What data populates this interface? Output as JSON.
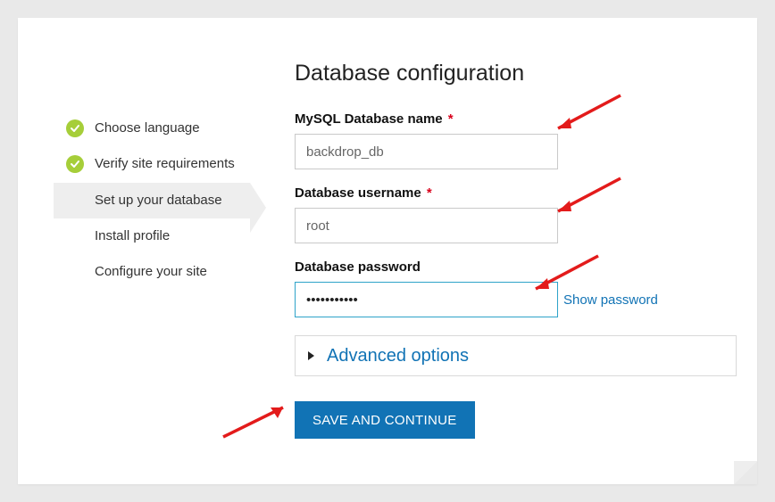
{
  "page_title": "Database configuration",
  "sidebar": {
    "items": [
      {
        "label": "Choose language",
        "state": "done"
      },
      {
        "label": "Verify site requirements",
        "state": "done"
      },
      {
        "label": "Set up your database",
        "state": "active"
      },
      {
        "label": "Install profile",
        "state": "pending"
      },
      {
        "label": "Configure your site",
        "state": "pending"
      }
    ]
  },
  "fields": {
    "db_name": {
      "label": "MySQL Database name",
      "required": true,
      "value": "backdrop_db"
    },
    "db_user": {
      "label": "Database username",
      "required": true,
      "value": "root"
    },
    "db_pass": {
      "label": "Database password",
      "required": false,
      "value": "•••••••••••",
      "show_label": "Show password"
    }
  },
  "advanced_label": "Advanced options",
  "save_button_label": "Save and continue",
  "required_marker": "*",
  "colors": {
    "accent": "#1173b5",
    "success": "#a6ce39",
    "error": "#d9001b"
  }
}
